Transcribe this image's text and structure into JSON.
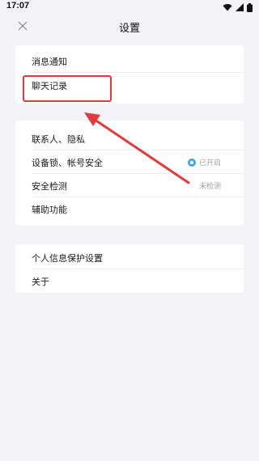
{
  "status_bar": {
    "time": "17:07"
  },
  "header": {
    "title": "设置"
  },
  "groups": [
    {
      "items": [
        {
          "label": "消息通知"
        },
        {
          "label": "聊天记录"
        }
      ]
    },
    {
      "items": [
        {
          "label": "联系人、隐私"
        },
        {
          "label": "设备锁、帐号安全",
          "status": "已开启"
        },
        {
          "label": "安全检测",
          "status": "未检测"
        },
        {
          "label": "辅助功能"
        }
      ]
    },
    {
      "items": [
        {
          "label": "个人信息保护设置"
        },
        {
          "label": "关于"
        }
      ]
    }
  ],
  "colors": {
    "background": "#f2f2f7",
    "card": "#ffffff",
    "accent": "#3fa6e8",
    "annotation": "#e23b3b"
  },
  "icons": {
    "back": "close-icon",
    "status_on": "shield-check-icon"
  }
}
